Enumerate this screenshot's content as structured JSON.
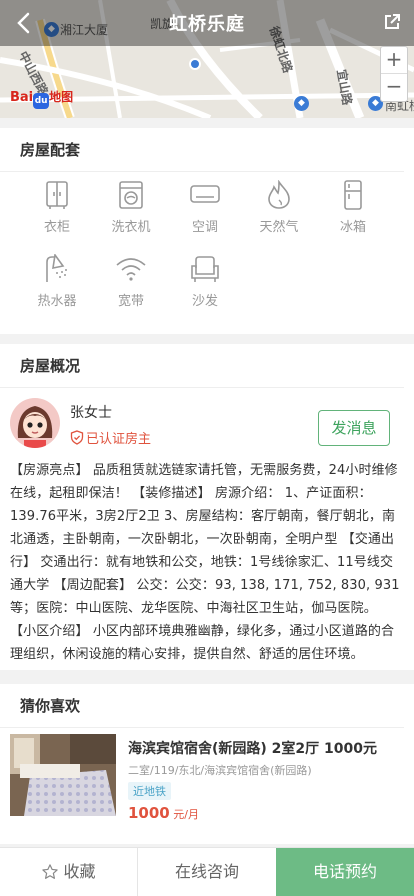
{
  "header": {
    "title": "虹桥乐庭"
  },
  "map": {
    "labels": [
      "湘江大厦",
      "凯旋",
      "中山西路",
      "徐虹北路",
      "宜山路",
      "南虹桥"
    ],
    "zoom_in": "+",
    "zoom_out": "−",
    "logo_text_1": "Bai",
    "logo_paw": "du",
    "logo_text_2": "地图"
  },
  "amenities": {
    "title": "房屋配套",
    "items": [
      {
        "label": "衣柜",
        "icon": "wardrobe-icon"
      },
      {
        "label": "洗衣机",
        "icon": "washing-machine-icon"
      },
      {
        "label": "空调",
        "icon": "air-conditioner-icon"
      },
      {
        "label": "天然气",
        "icon": "flame-icon"
      },
      {
        "label": "冰箱",
        "icon": "fridge-icon"
      },
      {
        "label": "热水器",
        "icon": "shower-icon"
      },
      {
        "label": "宽带",
        "icon": "wifi-icon"
      },
      {
        "label": "沙发",
        "icon": "sofa-icon"
      }
    ]
  },
  "overview": {
    "title": "房屋概况",
    "host_name": "张女士",
    "verified_label": "已认证房主",
    "message_button": "发消息",
    "description": "【房源亮点】 品质租赁就选链家请托管，无需服务费，24小时维修在线，起租即保洁！ 【装修描述】 房源介绍： 1、产证面积：139.76平米，3房2厅2卫 3、房屋结构：客厅朝南，餐厅朝北，南北通透，主卧朝南，一次卧朝北，一次卧朝南，全明户型 【交通出行】 交通出行：就有地铁和公交，地铁：1号线徐家汇、11号线交通大学 【周边配套】 公交：公交：93, 138, 171, 752, 830, 931等；医院：中山医院、龙华医院、中海社区卫生站，伽马医院。 【小区介绍】 小区内部环境典雅幽静，绿化多，通过小区道路的合理组织，休闲设施的精心安排，提供自然、舒适的居住环境。"
  },
  "recommend": {
    "title": "猜你喜欢",
    "item": {
      "title": "海滨宾馆宿舍(新园路) 2室2厅 1000元",
      "subtitle": "二室/119/东北/海滨宾馆宿舍(新园路)",
      "tag": "近地铁",
      "price": "1000",
      "price_unit": " 元/月"
    }
  },
  "bottombar": {
    "favorite": "收藏",
    "consult": "在线咨询",
    "call": "电话预约"
  },
  "colors": {
    "accent": "#6dbb85",
    "price": "#e0533e",
    "verified": "#e0533e"
  }
}
